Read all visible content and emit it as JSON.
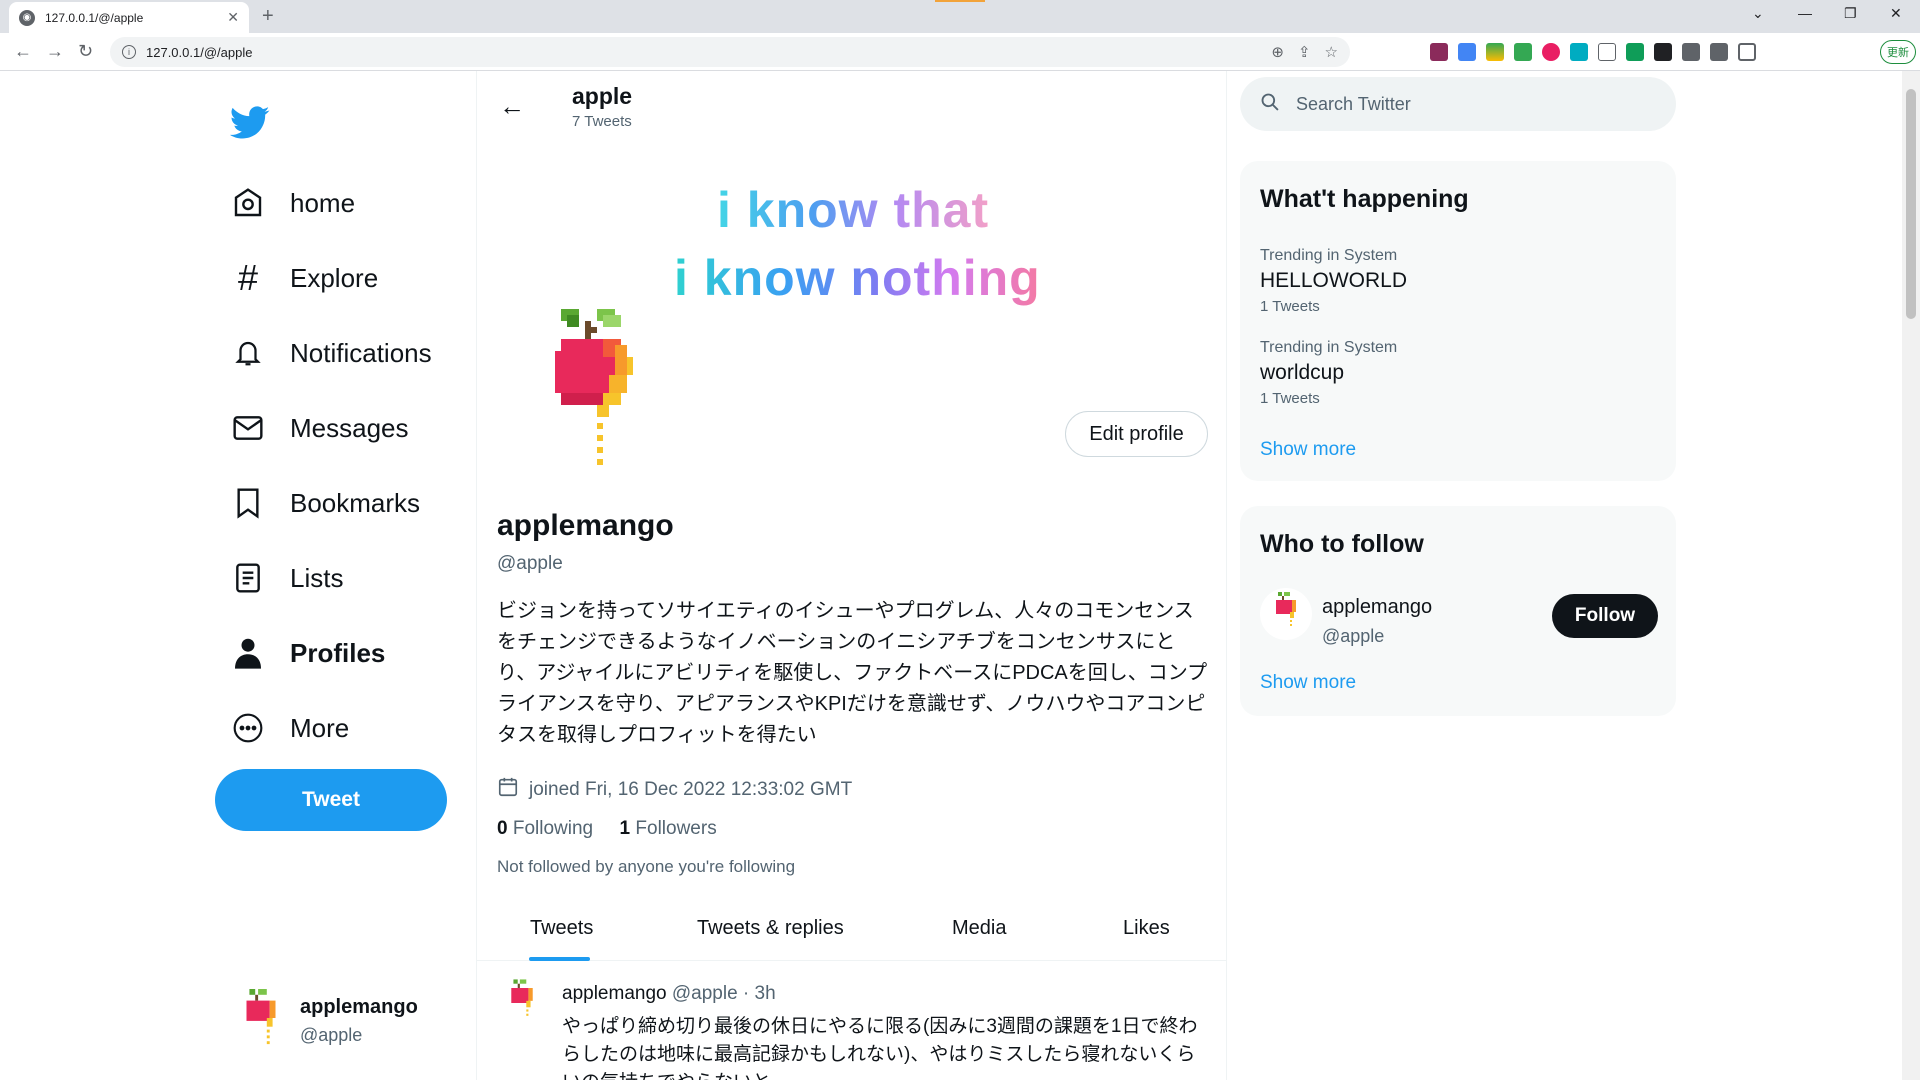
{
  "browser": {
    "tab_title": "127.0.0.1/@/apple",
    "url": "127.0.0.1/@/apple",
    "update_label": "更新"
  },
  "nav": {
    "items": [
      {
        "label": "home",
        "icon": "home-icon"
      },
      {
        "label": "Explore",
        "icon": "hashtag-icon"
      },
      {
        "label": "Notifications",
        "icon": "bell-icon"
      },
      {
        "label": "Messages",
        "icon": "envelope-icon"
      },
      {
        "label": "Bookmarks",
        "icon": "bookmark-icon"
      },
      {
        "label": "Lists",
        "icon": "list-icon"
      },
      {
        "label": "Profiles",
        "icon": "person-icon"
      },
      {
        "label": "More",
        "icon": "more-icon"
      }
    ],
    "tweet_button": "Tweet",
    "account": {
      "name": "applemango",
      "handle": "@apple"
    }
  },
  "header": {
    "title": "apple",
    "subtitle": "7 Tweets"
  },
  "banner": {
    "line1": "i know that",
    "line2": "i know nothing"
  },
  "profile": {
    "edit_label": "Edit profile",
    "name": "applemango",
    "handle": "@apple",
    "bio": "ビジョンを持ってソサイエティのイシューやプログレム、人々のコモンセンスをチェンジできるようなイノベーションのイニシアチブをコンセンサスにとり、アジャイルにアビリティを駆使し、ファクトベースにPDCAを回し、コンプライアンスを守り、アピアランスやKPIだけを意識せず、ノウハウやコアコンピタスを取得しプロフィットを得たい",
    "joined": "joined Fri, 16 Dec 2022 12:33:02 GMT",
    "following_count": "0",
    "following_label": "Following",
    "followers_count": "1",
    "followers_label": "Followers",
    "not_followed": "Not followed by anyone you're following"
  },
  "tabs": [
    "Tweets",
    "Tweets & replies",
    "Media",
    "Likes"
  ],
  "tweet": {
    "name": "applemango",
    "handle_time": "@apple · 3h",
    "text": "やっぱり締め切り最後の休日にやるに限る(因みに3週間の課題を1日で終わらしたのは地味に最高記録かもしれない)、やはりミスしたら寝れないくらいの気持ちでやらないと"
  },
  "search": {
    "placeholder": "Search Twitter"
  },
  "trends": {
    "title": "What't happening",
    "items": [
      {
        "context": "Trending in System",
        "name": "HELLOWORLD",
        "count": "1 Tweets"
      },
      {
        "context": "Trending in System",
        "name": "worldcup",
        "count": "1 Tweets"
      }
    ],
    "show_more": "Show more"
  },
  "who_to_follow": {
    "title": "Who to follow",
    "name": "applemango",
    "handle": "@apple",
    "follow_label": "Follow",
    "show_more": "Show more"
  },
  "colors": {
    "accent": "#1d9bf0",
    "text": "#0f1419",
    "muted": "#536471"
  }
}
